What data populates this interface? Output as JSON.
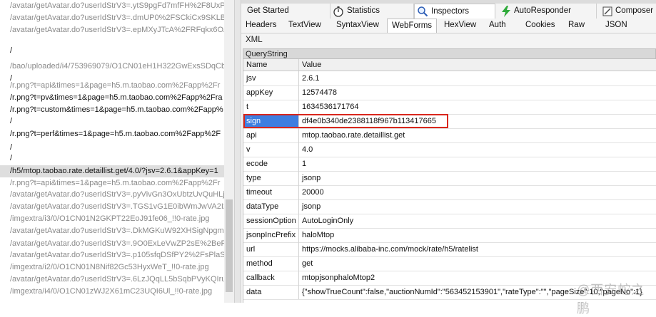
{
  "session_list": {
    "rows": [
      {
        "text": "/avatar/getAvatar.do?userIdStrV3=.ytS9pgFd7mfFH%2F8UxP",
        "dark": false
      },
      {
        "text": "/avatar/getAvatar.do?userIdStrV3=.dmUP0%2FSCkiCx9SKLB9",
        "dark": false
      },
      {
        "text": "/avatar/getAvatar.do?userIdStrV3=.epMXyJTcA%2FRFqkx6OA",
        "dark": false
      },
      {
        "text": "/",
        "dark": true
      },
      {
        "text": "/bao/uploaded/i4/753969079/O1CN01eH1H322GwExsSDqCb_",
        "dark": false
      },
      {
        "text": "/",
        "dark": true
      },
      {
        "text": "/r.png?t=api&times=1&page=h5.m.taobao.com%2Fapp%2Fr",
        "dark": false
      },
      {
        "text": "/r.png?t=pv&times=1&page=h5.m.taobao.com%2Fapp%2Fra",
        "dark": true
      },
      {
        "text": "/r.png?t=custom&times=1&page=h5.m.taobao.com%2Fapp%",
        "dark": true
      },
      {
        "text": "/",
        "dark": true
      },
      {
        "text": "/r.png?t=perf&times=1&page=h5.m.taobao.com%2Fapp%2F",
        "dark": true
      },
      {
        "text": "/",
        "dark": true
      },
      {
        "text": "/",
        "dark": true
      },
      {
        "text": "/h5/mtop.taobao.rate.detaillist.get/4.0/?jsv=2.6.1&appKey=1",
        "dark": true,
        "selected": true
      },
      {
        "text": "/r.png?t=api&times=1&page=h5.m.taobao.com%2Fapp%2Fr",
        "dark": false
      },
      {
        "text": "/avatar/getAvatar.do?userIdStrV3=.pyVivGn3OxUbtzUvQuHLj",
        "dark": false
      },
      {
        "text": "/avatar/getAvatar.do?userIdStrV3=.TGS1vG1E0ibWmJwVA2Iz",
        "dark": false
      },
      {
        "text": "/imgextra/i3/0/O1CN01N2GKPT22EoJ91fe06_!!0-rate.jpg",
        "dark": false
      },
      {
        "text": "/avatar/getAvatar.do?userIdStrV3=.DkMGKuW92XHSigNpgmk6",
        "dark": false
      },
      {
        "text": "/avatar/getAvatar.do?userIdStrV3=.9O0ExLeVwZP2sE%2BeFf",
        "dark": false
      },
      {
        "text": "/avatar/getAvatar.do?userIdStrV3=.p105sfqDSfPY2%2FsPlaSf",
        "dark": false
      },
      {
        "text": "/imgextra/i2/0/O1CN01N8Nif82Gc53HyxWeT_!!0-rate.jpg",
        "dark": false
      },
      {
        "text": "/avatar/getAvatar.do?userIdStrV3=.6LzJQqLL5bSqbPVyKQIruC",
        "dark": false
      },
      {
        "text": "/imgextra/i4/0/O1CN01zWJ2X61mC23UQI6Ul_!!0-rate.jpg",
        "dark": false
      }
    ]
  },
  "tabs_top": [
    {
      "label": "Get Started",
      "icon": "none",
      "active": false
    },
    {
      "label": "Statistics",
      "icon": "stopwatch-icon",
      "active": false
    },
    {
      "label": "Inspectors",
      "icon": "magnifier-icon",
      "active": true
    },
    {
      "label": "AutoResponder",
      "icon": "lightning-icon",
      "active": false
    },
    {
      "label": "Composer",
      "icon": "composer-icon",
      "active": false
    }
  ],
  "tabs_inspector": [
    {
      "label": "Headers",
      "active": false
    },
    {
      "label": "TextView",
      "active": false
    },
    {
      "label": "SyntaxView",
      "active": false
    },
    {
      "label": "WebForms",
      "active": true
    },
    {
      "label": "HexView",
      "active": false
    },
    {
      "label": "Auth",
      "active": false
    },
    {
      "label": "Cookies",
      "active": false
    },
    {
      "label": "Raw",
      "active": false
    },
    {
      "label": "JSON",
      "active": false
    }
  ],
  "tab_xml": "XML",
  "section_title": "QueryString",
  "columns": {
    "name": "Name",
    "value": "Value"
  },
  "params": [
    {
      "name": "jsv",
      "value": "2.6.1"
    },
    {
      "name": "appKey",
      "value": "12574478"
    },
    {
      "name": "t",
      "value": "1634536171764"
    },
    {
      "name": "sign",
      "value": "df4e0b340de2388118f967b113417665",
      "highlighted": true
    },
    {
      "name": "api",
      "value": "mtop.taobao.rate.detaillist.get"
    },
    {
      "name": "v",
      "value": "4.0"
    },
    {
      "name": "ecode",
      "value": "1"
    },
    {
      "name": "type",
      "value": "jsonp"
    },
    {
      "name": "timeout",
      "value": "20000"
    },
    {
      "name": "dataType",
      "value": "jsonp"
    },
    {
      "name": "sessionOption",
      "value": "AutoLoginOnly"
    },
    {
      "name": "jsonpIncPrefix",
      "value": "haloMtop"
    },
    {
      "name": "url",
      "value": "https://mocks.alibaba-inc.com/mock/rate/h5/ratelist"
    },
    {
      "name": "method",
      "value": "get"
    },
    {
      "name": "callback",
      "value": "mtopjsonphaloMtop2"
    },
    {
      "name": "data",
      "value": "{\"showTrueCount\":false,\"auctionNumId\":\"563452153901\",\"rateType\":\"\",\"pageSize\":10,\"pageNo\":1}"
    }
  ],
  "colors": {
    "highlight": "#3d7ee0",
    "annotation": "#d9261c"
  },
  "watermark": "@西安蛇之鹏"
}
